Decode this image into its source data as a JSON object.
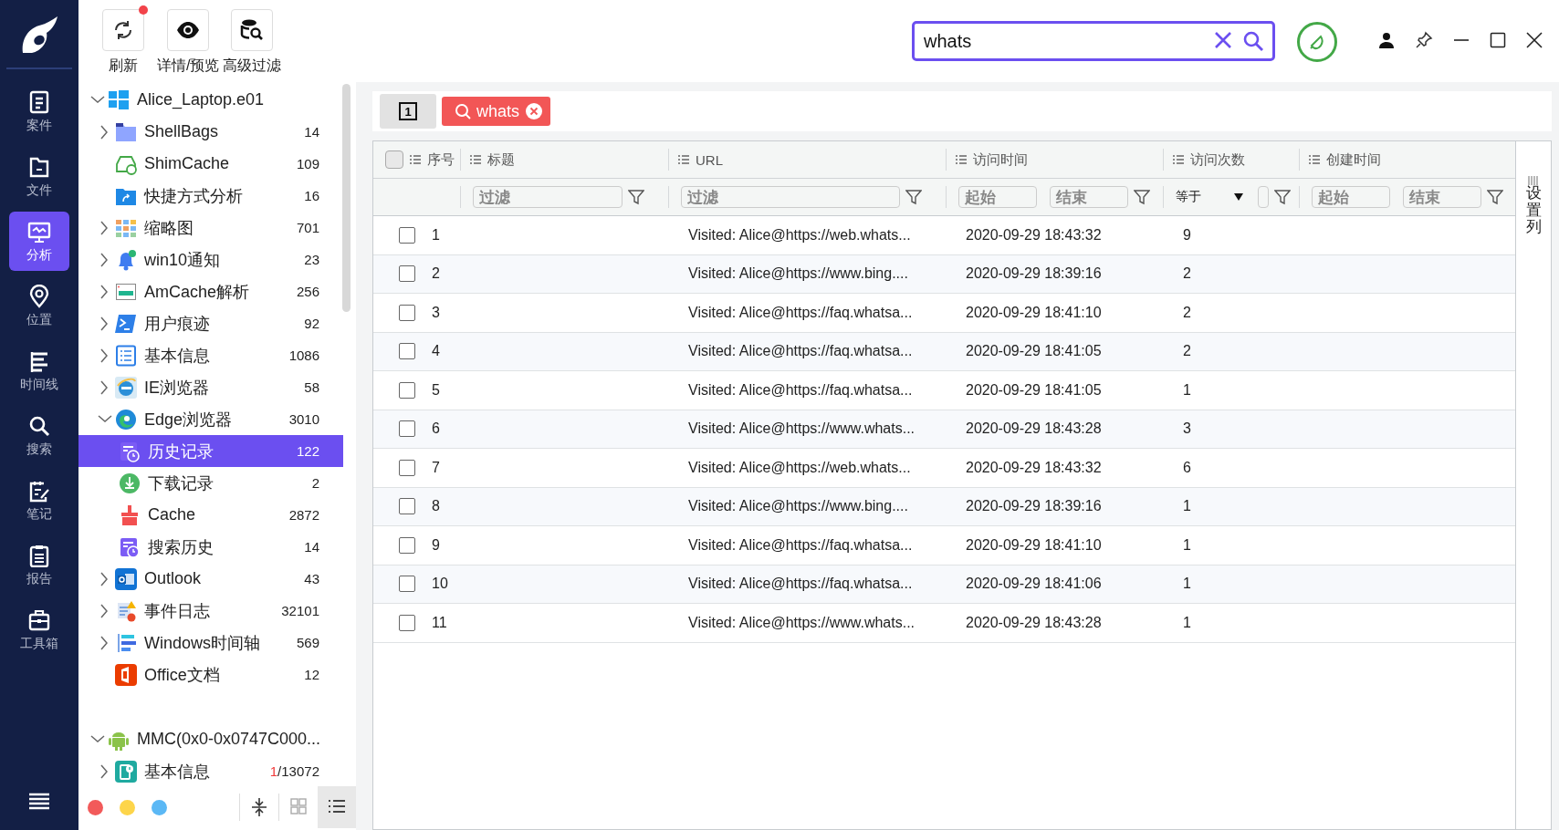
{
  "nav": [
    {
      "label": "案件",
      "selected": false
    },
    {
      "label": "文件",
      "selected": false
    },
    {
      "label": "分析",
      "selected": true
    },
    {
      "label": "位置",
      "selected": false
    },
    {
      "label": "时间线",
      "selected": false
    },
    {
      "label": "搜索",
      "selected": false
    },
    {
      "label": "笔记",
      "selected": false
    },
    {
      "label": "报告",
      "selected": false
    },
    {
      "label": "工具箱",
      "selected": false
    }
  ],
  "toolbar": [
    {
      "label": "刷新",
      "badge": true
    },
    {
      "label": "详情/预览",
      "badge": false
    },
    {
      "label": "高级过滤",
      "badge": false
    }
  ],
  "search": {
    "value": "whats"
  },
  "tree": [
    {
      "label": "Alice_Laptop.e01",
      "expanded": true,
      "children": [
        {
          "label": "ShellBags",
          "count": "14",
          "expanded": false,
          "selected": false,
          "has_children": true
        },
        {
          "label": "ShimCache",
          "count": "109",
          "expanded": false,
          "selected": false,
          "has_children": false
        },
        {
          "label": "快捷方式分析",
          "count": "16",
          "expanded": false,
          "selected": false,
          "has_children": false
        },
        {
          "label": "缩略图",
          "count": "701",
          "expanded": false,
          "selected": false,
          "has_children": true
        },
        {
          "label": "win10通知",
          "count": "23",
          "expanded": false,
          "selected": false,
          "has_children": true
        },
        {
          "label": "AmCache解析",
          "count": "256",
          "expanded": false,
          "selected": false,
          "has_children": true
        },
        {
          "label": "用户痕迹",
          "count": "92",
          "expanded": false,
          "selected": false,
          "has_children": true
        },
        {
          "label": "基本信息",
          "count": "1086",
          "expanded": false,
          "selected": false,
          "has_children": true
        },
        {
          "label": "IE浏览器",
          "count": "58",
          "expanded": false,
          "selected": false,
          "has_children": true
        },
        {
          "label": "Edge浏览器",
          "count": "3010",
          "expanded": true,
          "selected": false,
          "has_children": true,
          "children": [
            {
              "label": "历史记录",
              "count": "122",
              "selected": true
            },
            {
              "label": "下载记录",
              "count": "2",
              "selected": false
            },
            {
              "label": "Cache",
              "count": "2872",
              "selected": false
            },
            {
              "label": "搜索历史",
              "count": "14",
              "selected": false
            }
          ]
        },
        {
          "label": "Outlook",
          "count": "43",
          "expanded": false,
          "selected": false,
          "has_children": true
        },
        {
          "label": "事件日志",
          "count": "32101",
          "expanded": false,
          "selected": false,
          "has_children": true
        },
        {
          "label": "Windows时间轴",
          "count": "569",
          "expanded": false,
          "selected": false,
          "has_children": true
        },
        {
          "label": "Office文档",
          "count": "12",
          "expanded": false,
          "selected": false,
          "has_children": false
        }
      ]
    },
    {
      "label": "MMC(0x0-0x0747C000...",
      "expanded": true,
      "children": [
        {
          "label": "基本信息",
          "count_alert": "1",
          "count": "/13072",
          "expanded": false,
          "selected": false,
          "has_children": true
        }
      ]
    }
  ],
  "bottom_bar": {
    "dots": [
      {
        "color": "#f25a5a"
      },
      {
        "color": "#fdd54a"
      },
      {
        "color": "#5bb8f5"
      }
    ],
    "views": [
      {
        "kind": "collapse",
        "selected": false
      },
      {
        "kind": "grid",
        "selected": false
      },
      {
        "kind": "list",
        "selected": true
      }
    ]
  },
  "page_tab": {
    "label": "1"
  },
  "filter_chip": {
    "label": "whats"
  },
  "table": {
    "columns": [
      {
        "label": "序号"
      },
      {
        "label": "标题",
        "placeholder": "过滤"
      },
      {
        "label": "URL",
        "placeholder": "过滤"
      },
      {
        "label": "访问时间",
        "from": "起始",
        "to": "结束"
      },
      {
        "label": "访问次数",
        "operator": "等于"
      },
      {
        "label": "创建时间",
        "from": "起始",
        "to": "结束"
      }
    ],
    "settings_label": "设置列",
    "all_checked": false,
    "rows": [
      {
        "n": "1",
        "url": "Visited: Alice@https://web.whats...",
        "time": "2020-09-29 18:43:32",
        "count": "9",
        "checked": false
      },
      {
        "n": "2",
        "url": "Visited: Alice@https://www.bing....",
        "time": "2020-09-29 18:39:16",
        "count": "2",
        "checked": false
      },
      {
        "n": "3",
        "url": "Visited: Alice@https://faq.whatsa...",
        "time": "2020-09-29 18:41:10",
        "count": "2",
        "checked": false
      },
      {
        "n": "4",
        "url": "Visited: Alice@https://faq.whatsa...",
        "time": "2020-09-29 18:41:05",
        "count": "2",
        "checked": false
      },
      {
        "n": "5",
        "url": "Visited: Alice@https://faq.whatsa...",
        "time": "2020-09-29 18:41:05",
        "count": "1",
        "checked": false
      },
      {
        "n": "6",
        "url": "Visited: Alice@https://www.whats...",
        "time": "2020-09-29 18:43:28",
        "count": "3",
        "checked": false
      },
      {
        "n": "7",
        "url": "Visited: Alice@https://web.whats...",
        "time": "2020-09-29 18:43:32",
        "count": "6",
        "checked": false
      },
      {
        "n": "8",
        "url": "Visited: Alice@https://www.bing....",
        "time": "2020-09-29 18:39:16",
        "count": "1",
        "checked": false
      },
      {
        "n": "9",
        "url": "Visited: Alice@https://faq.whatsa...",
        "time": "2020-09-29 18:41:10",
        "count": "1",
        "checked": false
      },
      {
        "n": "10",
        "url": "Visited: Alice@https://faq.whatsa...",
        "time": "2020-09-29 18:41:06",
        "count": "1",
        "checked": false
      },
      {
        "n": "11",
        "url": "Visited: Alice@https://www.whats...",
        "time": "2020-09-29 18:43:28",
        "count": "1",
        "checked": false
      }
    ]
  }
}
